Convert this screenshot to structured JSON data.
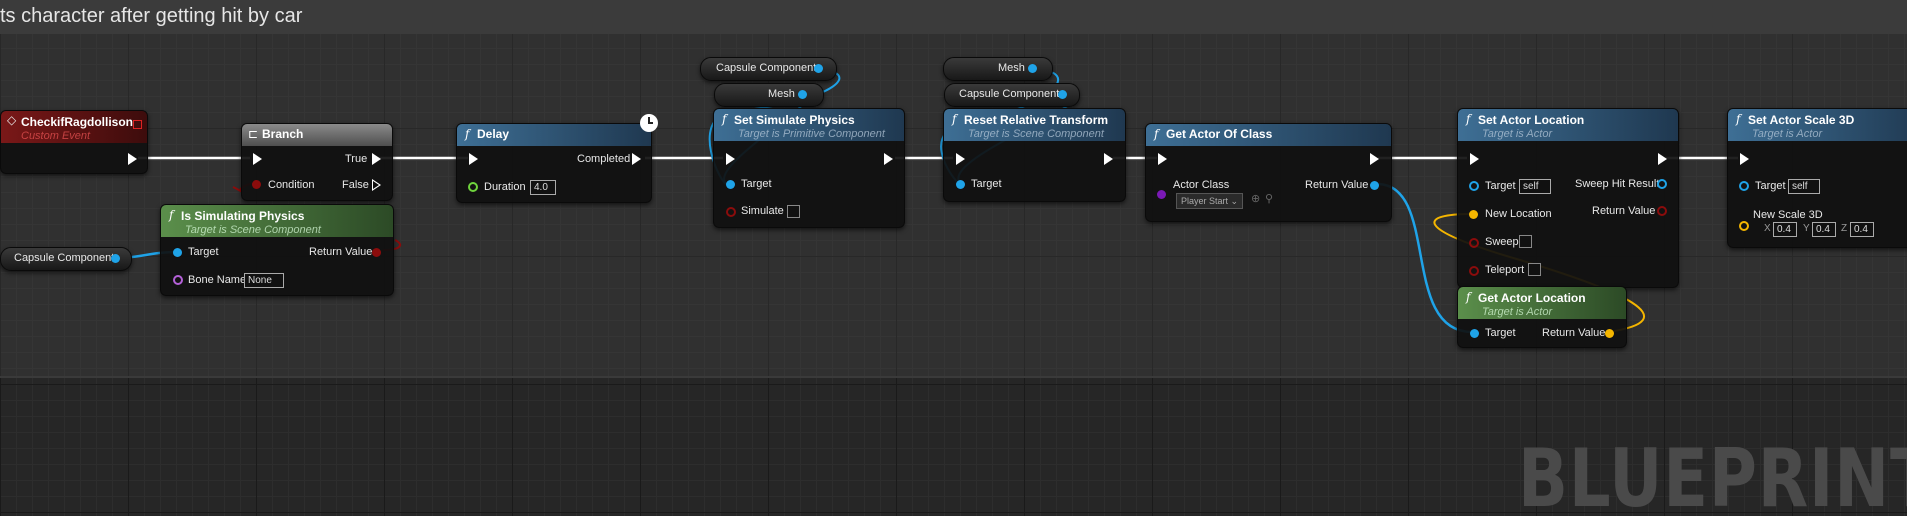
{
  "comment": "ts character after getting hit by car",
  "watermark": "BLUEPRINT",
  "colors": {
    "exec": "#ffffff",
    "object_pin": "#1fa3e8",
    "bool_pin": "#8b0c0c",
    "vector_pin": "#f5b600",
    "float_pin": "#6fd43d",
    "name_pin": "#b461d8",
    "class_pin": "#7a19b5",
    "event_header": "#7a1818",
    "function_header": "#3e6f95",
    "pure_header": "#5b8f4b"
  },
  "nodes": {
    "event": {
      "title": "CheckifRagdollison",
      "subtitle": "Custom Event",
      "icon": "event-diamond-icon"
    },
    "branch": {
      "title": "Branch",
      "true": "True",
      "false": "False",
      "condition": "Condition",
      "icon": "branch-icon"
    },
    "is_sim": {
      "title": "Is Simulating Physics",
      "subtitle": "Target is Scene Component",
      "target": "Target",
      "return": "Return Value",
      "bone": "Bone Name",
      "bone_value": "None"
    },
    "capsule_var1": {
      "label": "Capsule Component"
    },
    "delay": {
      "title": "Delay",
      "completed": "Completed",
      "duration": "Duration",
      "duration_value": "4.0"
    },
    "sim_var_capsule": {
      "label": "Capsule Component"
    },
    "sim_var_mesh": {
      "label": "Mesh"
    },
    "set_sim": {
      "title": "Set Simulate Physics",
      "subtitle": "Target is Primitive Component",
      "target": "Target",
      "simulate": "Simulate"
    },
    "reset_var_mesh": {
      "label": "Mesh"
    },
    "reset_var_capsule": {
      "label": "Capsule Component"
    },
    "reset": {
      "title": "Reset Relative Transform",
      "subtitle": "Target is Scene Component",
      "target": "Target"
    },
    "get_actor": {
      "title": "Get Actor Of Class",
      "actor_class": "Actor Class",
      "class_value": "Player Start",
      "return": "Return Value"
    },
    "set_loc": {
      "title": "Set Actor Location",
      "subtitle": "Target is Actor",
      "target": "Target",
      "target_value": "self",
      "new_location": "New Location",
      "sweep": "Sweep",
      "teleport": "Teleport",
      "sweep_hit": "Sweep Hit Result",
      "return": "Return Value"
    },
    "get_loc": {
      "title": "Get Actor Location",
      "subtitle": "Target is Actor",
      "target": "Target",
      "return": "Return Value"
    },
    "set_scale": {
      "title": "Set Actor Scale 3D",
      "subtitle": "Target is Actor",
      "target": "Target",
      "target_value": "self",
      "new_scale": "New Scale 3D",
      "x_label": "X",
      "x": "0.4",
      "y_label": "Y",
      "y": "0.4",
      "z_label": "Z",
      "z": "0.4"
    }
  }
}
